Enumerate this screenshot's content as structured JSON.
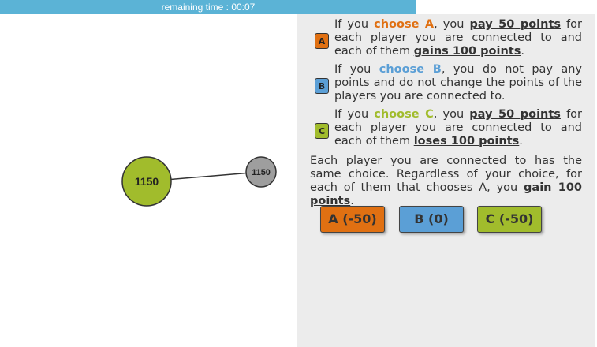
{
  "timer": {
    "text": "remaining time : 00:07",
    "color": "#5bb3d6"
  },
  "graph": {
    "self_node": {
      "label": "1150",
      "color": "#a1bc2c"
    },
    "neighbor_node": {
      "label": "1150",
      "color": "#9e9e9e"
    }
  },
  "options": [
    {
      "badge": "A",
      "color": "#e07012",
      "p1": "If you ",
      "choose": "choose A",
      "p2": ", you ",
      "em1": "pay 50 points",
      "p3": " for each player you are connected to and each of them ",
      "em2": "gains 100 points",
      "p4": "."
    },
    {
      "badge": "B",
      "color": "#5b9fd6",
      "p1": "If you ",
      "choose": "choose B",
      "p2": ", you do not pay any points and do not change the points of the players you are connected to."
    },
    {
      "badge": "C",
      "color": "#a1bc2c",
      "p1": "If you ",
      "choose": "choose C",
      "p2": ", you ",
      "em1": "pay 50 points",
      "p3": " for each player you are connected to and each of them ",
      "em2": "loses 100 points",
      "p4": "."
    }
  ],
  "note": {
    "p1": "Each player you are connected to has the same choice. Regardless of your choice, for each of them that chooses A, you ",
    "em": "gain 100 points",
    "p2": "."
  },
  "buttons": [
    {
      "label": "A (-50)",
      "color": "#e07012"
    },
    {
      "label": "B (0)",
      "color": "#5b9fd6"
    },
    {
      "label": "C (-50)",
      "color": "#a1bc2c"
    }
  ]
}
